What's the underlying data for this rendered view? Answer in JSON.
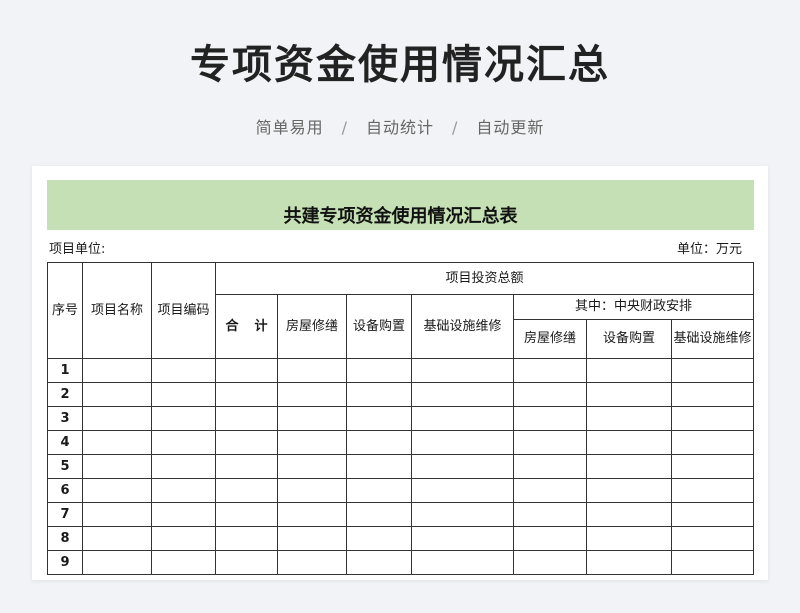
{
  "header": {
    "title": "专项资金使用情况汇总",
    "tags": [
      "简单易用",
      "自动统计",
      "自动更新"
    ],
    "separator": "/"
  },
  "sheet": {
    "title": "共建专项资金使用情况汇总表",
    "unit_left": "项目单位:",
    "unit_right": "单位：万元",
    "band_color": "#c5e0b4",
    "columns": {
      "seq": "序号",
      "name": "项目名称",
      "code": "项目编码",
      "total_group": "项目投资总额",
      "sum_a": "合",
      "sum_b": "计",
      "house": "房屋修缮",
      "equip": "设备购置",
      "infra": "基础设施维修",
      "central_group": "其中：中央财政安排",
      "c_house": "房屋修缮",
      "c_equip": "设备购置",
      "c_infra": "基础设施维修"
    },
    "rows": [
      "1",
      "2",
      "3",
      "4",
      "5",
      "6",
      "7",
      "8",
      "9"
    ]
  }
}
